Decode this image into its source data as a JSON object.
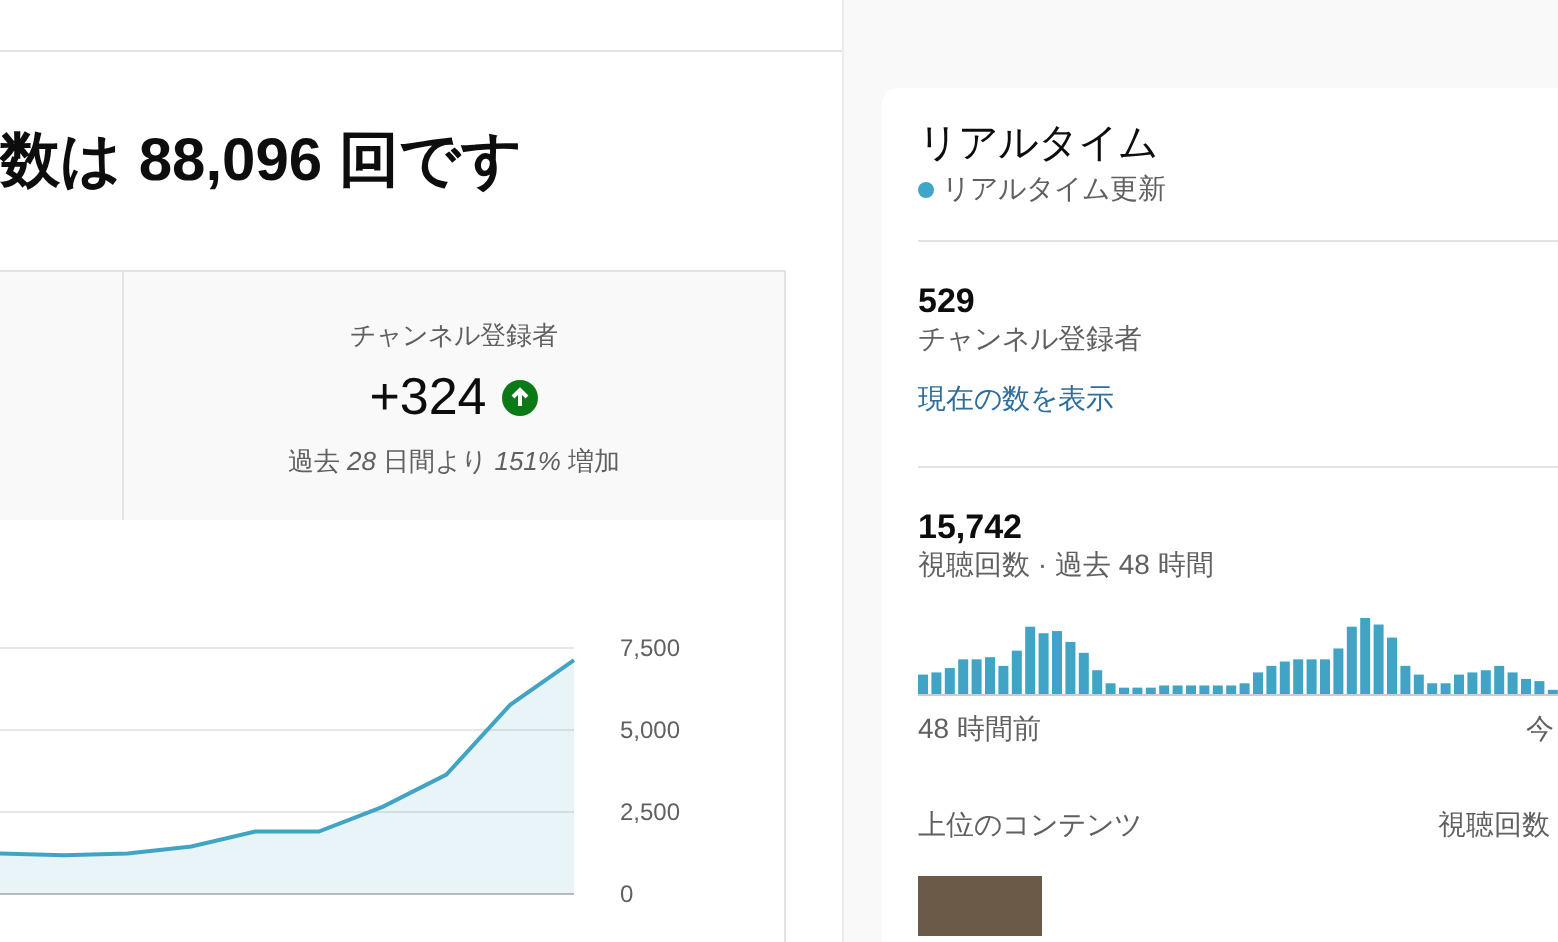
{
  "main": {
    "headline": "数は 88,096 回です",
    "stat": {
      "label": "チャンネル登録者",
      "value": "+324",
      "note": "過去 *28* 日間より *151%* 増加"
    },
    "chart_data": {
      "type": "area",
      "ylim": [
        0,
        7500
      ],
      "yticks": [
        {
          "value": 0,
          "label": "0"
        },
        {
          "value": 2500,
          "label": "2,500"
        },
        {
          "value": 5000,
          "label": "5,000"
        },
        {
          "value": 7500,
          "label": "7,500"
        }
      ],
      "series": [
        {
          "color": "#41a4c4",
          "values": [
            1240,
            1180,
            1240,
            1450,
            1900,
            1900,
            2660,
            3640,
            5770,
            7130
          ]
        }
      ]
    }
  },
  "realtime": {
    "title": "リアルタイム",
    "status": "リアルタイム更新",
    "subscribers": {
      "value": "529",
      "label": "チャンネル登録者",
      "link": "現在の数を表示"
    },
    "views": {
      "value": "15,742",
      "label": "視聴回数 · 過去 48 時間",
      "start_label": "48 時間前",
      "end_label": "今"
    },
    "top_content": {
      "label": "上位のコンテンツ",
      "column": "視聴回数"
    }
  }
}
